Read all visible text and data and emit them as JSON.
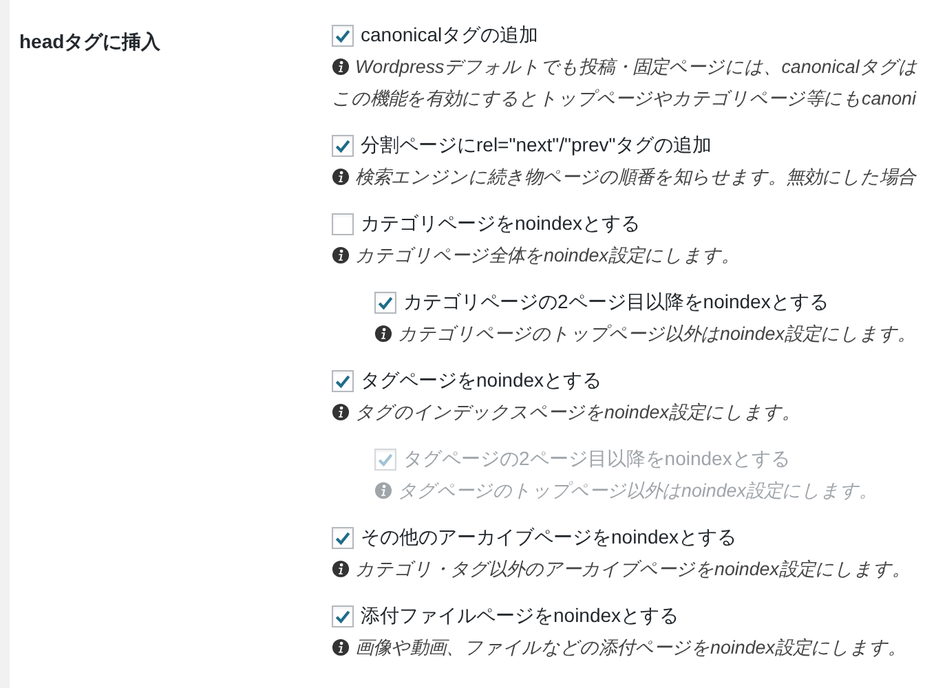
{
  "section": {
    "label": "headタグに挿入"
  },
  "options": [
    {
      "label": "canonicalタグの追加",
      "checked": true,
      "disabled": false,
      "description": [
        "Wordpressデフォルトでも投稿・固定ページには、canonicalタグは",
        "この機能を有効にするとトップページやカテゴリページ等にもcanoni"
      ]
    },
    {
      "label": "分割ページにrel=\"next\"/\"prev\"タグの追加",
      "checked": true,
      "disabled": false,
      "description": [
        "検索エンジンに続き物ページの順番を知らせます。無効にした場合"
      ]
    },
    {
      "label": "カテゴリページをnoindexとする",
      "checked": false,
      "disabled": false,
      "description": [
        "カテゴリページ全体をnoindex設定にします。"
      ],
      "children": [
        {
          "label": "カテゴリページの2ページ目以降をnoindexとする",
          "checked": true,
          "disabled": false,
          "description": [
            "カテゴリページのトップページ以外はnoindex設定にします。"
          ]
        }
      ]
    },
    {
      "label": "タグページをnoindexとする",
      "checked": true,
      "disabled": false,
      "description": [
        "タグのインデックスページをnoindex設定にします。"
      ],
      "children": [
        {
          "label": "タグページの2ページ目以降をnoindexとする",
          "checked": true,
          "disabled": true,
          "description": [
            "タグページのトップページ以外はnoindex設定にします。"
          ]
        }
      ]
    },
    {
      "label": "その他のアーカイブページをnoindexとする",
      "checked": true,
      "disabled": false,
      "description": [
        "カテゴリ・タグ以外のアーカイブページをnoindex設定にします。"
      ]
    },
    {
      "label": "添付ファイルページをnoindexとする",
      "checked": true,
      "disabled": false,
      "description": [
        "画像や動画、ファイルなどの添付ページをnoindex設定にします。"
      ]
    }
  ]
}
